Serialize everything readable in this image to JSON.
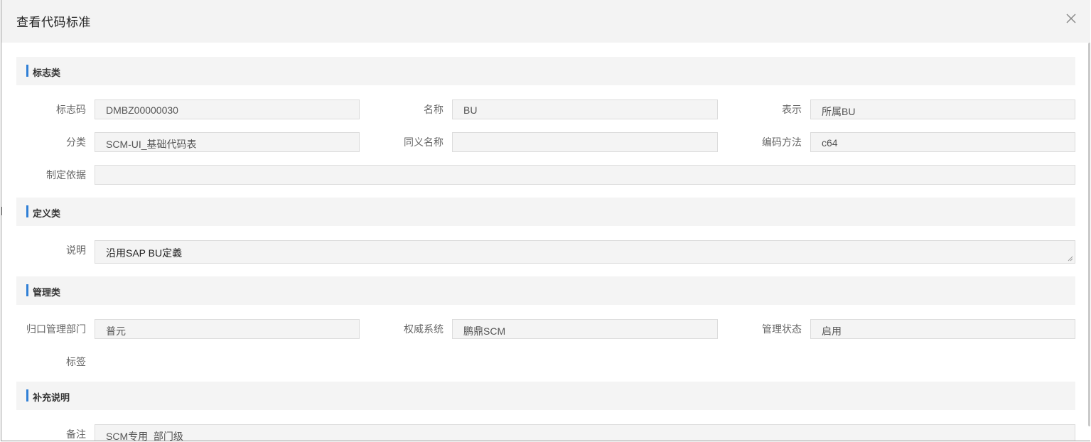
{
  "dialog": {
    "title": "查看代码标准",
    "close_icon": "close-icon"
  },
  "sections": {
    "flag": {
      "title": "标志类"
    },
    "definition": {
      "title": "定义类"
    },
    "management": {
      "title": "管理类"
    },
    "supplement": {
      "title": "补充说明"
    }
  },
  "fields": {
    "flag_code": {
      "label": "标志码",
      "value": "DMBZ00000030"
    },
    "name": {
      "label": "名称",
      "value": "BU"
    },
    "representation": {
      "label": "表示",
      "value": "所属BU"
    },
    "category": {
      "label": "分类",
      "value": "SCM-UI_基础代码表"
    },
    "synonym": {
      "label": "同义名称",
      "value": ""
    },
    "encoding_method": {
      "label": "编码方法",
      "value": "c64"
    },
    "basis": {
      "label": "制定依据",
      "value": ""
    },
    "description": {
      "label": "说明",
      "value": "沿用SAP BU定義"
    },
    "responsible_dept": {
      "label": "归口管理部门",
      "value": "普元"
    },
    "authority_system": {
      "label": "权威系统",
      "value": "鹏鼎SCM"
    },
    "management_status": {
      "label": "管理状态",
      "value": "启用"
    },
    "tags": {
      "label": "标签",
      "value": ""
    },
    "remark": {
      "label": "备注",
      "value": "SCM专用_部门级"
    }
  },
  "colors": {
    "accent": "#2f7fd6",
    "header_bg": "#f3f3f3",
    "section_bg": "#f4f4f4",
    "field_bg": "#f4f4f4"
  }
}
